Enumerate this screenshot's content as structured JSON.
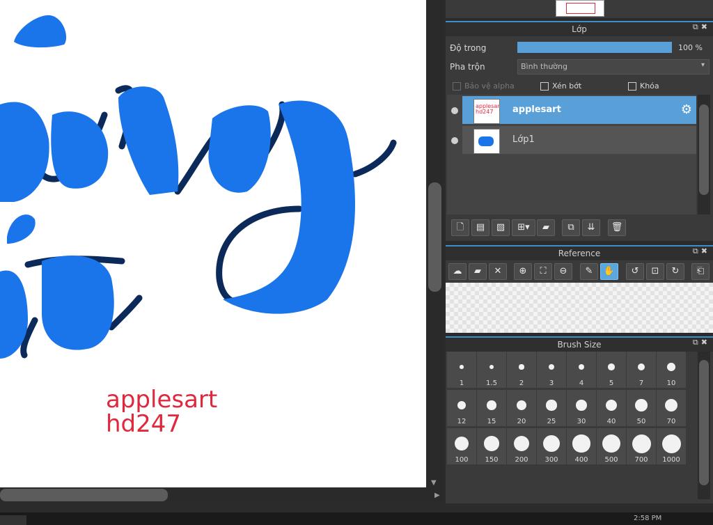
{
  "canvas": {
    "watermark_line1": "applesart",
    "watermark_line2": "hd247",
    "primary_color": "#1a74ea",
    "outline_color": "#0b2a5a",
    "watermark_color": "#e0283c"
  },
  "layer_panel": {
    "title": "Lớp",
    "opacity_label": "Độ trong",
    "opacity_value": "100 %",
    "opacity_percent": 100,
    "blend_label": "Pha trộn",
    "blend_value": "Bình thường",
    "protect_alpha_label": "Bảo vệ alpha",
    "clipping_label": "Xén bớt",
    "lock_label": "Khóa",
    "layers": [
      {
        "name": "applesart",
        "thumb_text": "applesart hd247",
        "selected": true
      },
      {
        "name": "Lớp1",
        "selected": false
      }
    ],
    "accent_color": "#5aa0d8"
  },
  "reference_panel": {
    "title": "Reference"
  },
  "brush_panel": {
    "title": "Brush Size",
    "sizes": [
      "1",
      "1.5",
      "2",
      "3",
      "4",
      "5",
      "7",
      "10",
      "12",
      "15",
      "20",
      "25",
      "30",
      "40",
      "50",
      "70",
      "100",
      "150",
      "200",
      "300",
      "400",
      "500",
      "700",
      "1000"
    ]
  },
  "taskbar": {
    "clock": "2:58 PM"
  }
}
